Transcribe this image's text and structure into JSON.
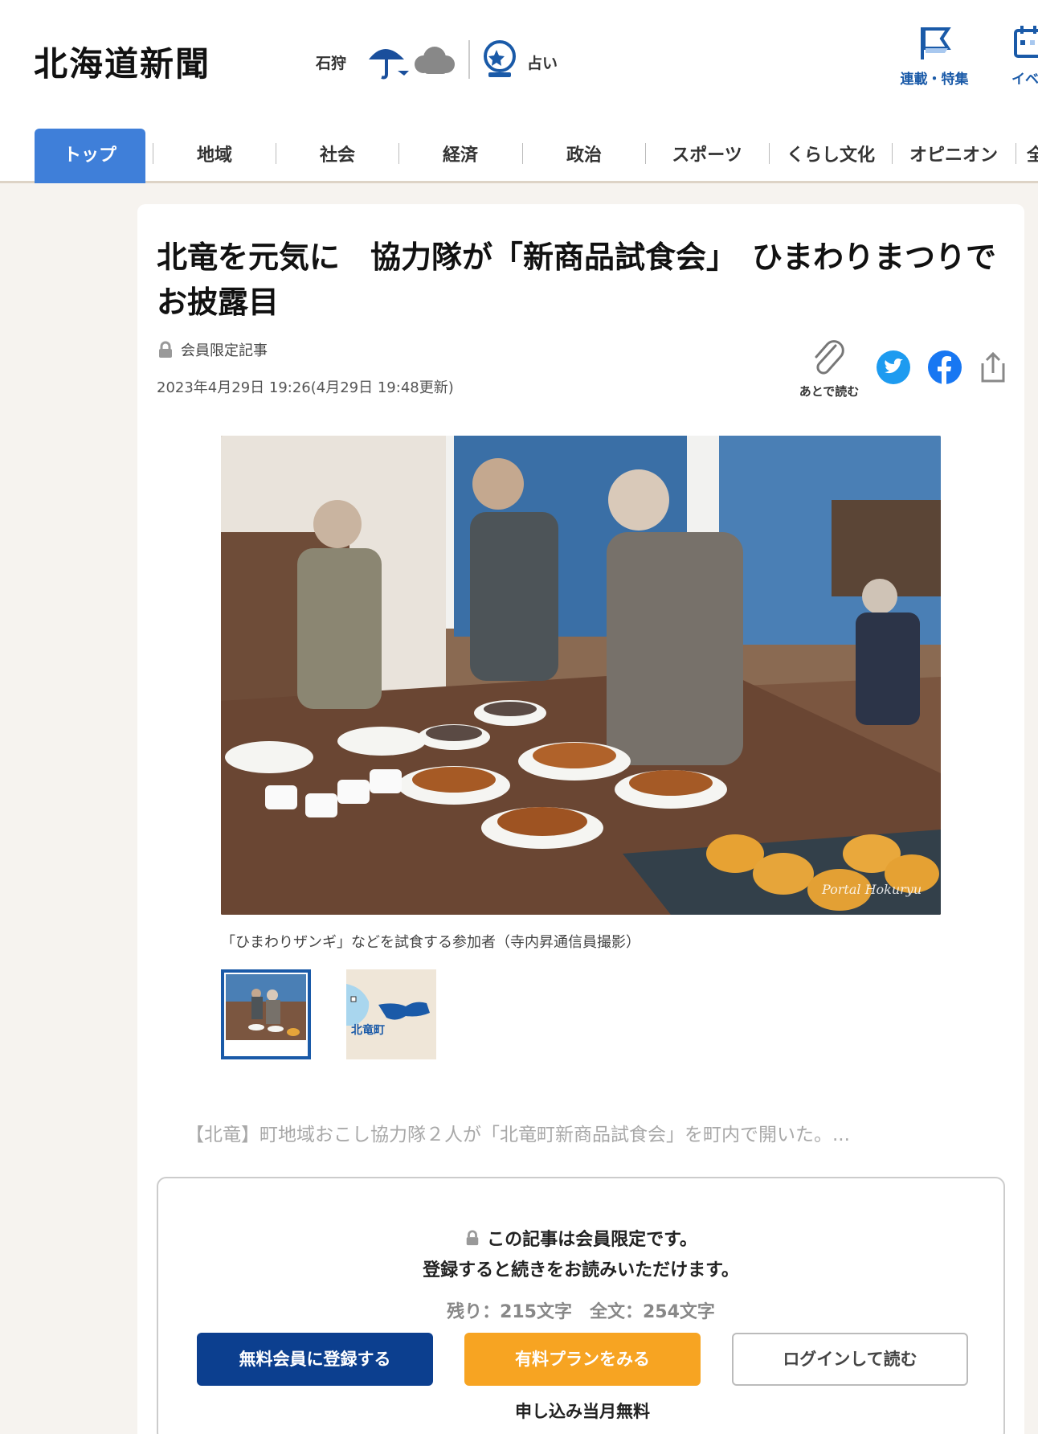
{
  "header": {
    "logo": "北海道新聞",
    "region": "石狩",
    "weather_icons": [
      "umbrella-rain-icon",
      "cloud-icon"
    ],
    "fortune": "占い",
    "links": [
      {
        "label": "連載・特集",
        "icon": "flag-icon"
      },
      {
        "label": "イベ",
        "icon": "calendar-icon"
      }
    ]
  },
  "nav": {
    "items": [
      "トップ",
      "地域",
      "社会",
      "経済",
      "政治",
      "スポーツ",
      "くらし文化",
      "オピニオン",
      "全"
    ]
  },
  "article": {
    "title": "北竜を元気に　協力隊が「新商品試食会」　ひまわりまつりでお披露目",
    "members_tag": "会員限定記事",
    "date": "2023年4月29日 19:26(4月29日 19:48更新)",
    "read_later": "あとで読む",
    "share_icons": [
      "twitter-icon",
      "facebook-icon",
      "share-icon"
    ],
    "photo_credit": "Portal Hokuryu",
    "caption": "「ひまわりザンギ」などを試食する参加者（寺内昇通信員撮影）",
    "map_label": "北竜町",
    "lead": "【北竜】町地域おこし協力隊２人が「北竜町新商品試食会」を町内で開いた。..."
  },
  "paywall": {
    "line1": "この記事は会員限定です。",
    "line2": "登録すると続きをお読みいただけます。",
    "count": "残り：215文字　全文：254文字",
    "btn_free": "無料会員に登録する",
    "btn_paid": "有料プランをみる",
    "btn_login": "ログインして読む",
    "note": "申し込み当月無料"
  },
  "colors": {
    "accent_blue": "#1a5aa8",
    "nav_active": "#3f7fd9",
    "btn_free": "#0c3f8f",
    "btn_paid": "#f7a422",
    "twitter": "#1d9bf0",
    "facebook": "#1877f2"
  }
}
